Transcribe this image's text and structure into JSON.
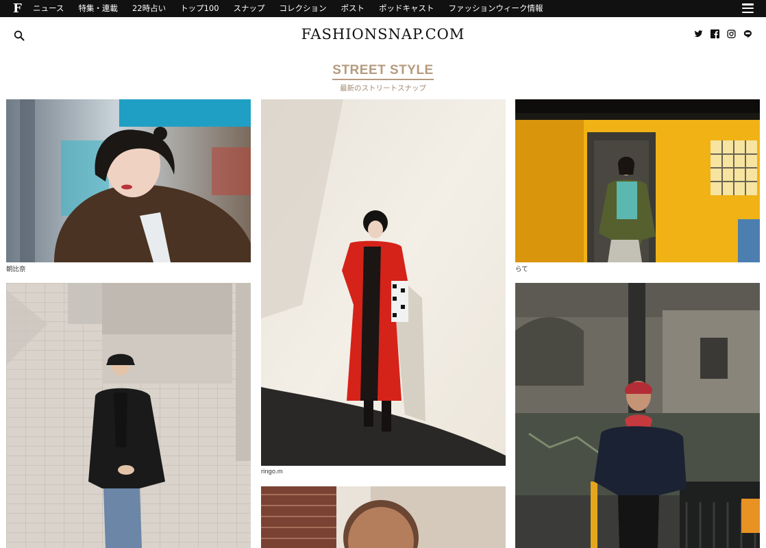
{
  "topbar": {
    "logo": "F",
    "nav": [
      "ニュース",
      "特集・連載",
      "22時占い",
      "トップ100",
      "スナップ",
      "コレクション",
      "ポスト",
      "ポッドキャスト",
      "ファッションウィーク情報"
    ]
  },
  "header": {
    "site_name": "FASHIONSNAP.COM",
    "social_icons": [
      "twitter-icon",
      "facebook-icon",
      "instagram-icon",
      "line-icon"
    ]
  },
  "section": {
    "title": "STREET STYLE",
    "subtitle": "最新のストリートスナップ"
  },
  "snaps": [
    {
      "name": "朝比奈"
    },
    {
      "name": "ringo.m"
    },
    {
      "name": "らて"
    }
  ],
  "colors": {
    "topbar": "#111111",
    "accent": "#b59a7e"
  }
}
